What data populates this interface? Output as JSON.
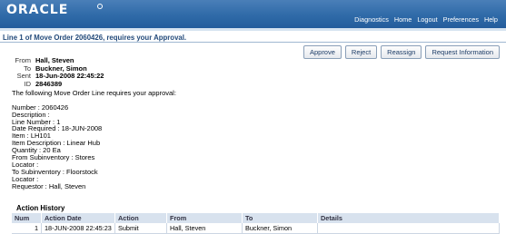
{
  "header": {
    "logo": "ORACLE",
    "nav": [
      "Diagnostics",
      "Home",
      "Logout",
      "Preferences",
      "Help"
    ]
  },
  "page_title": "Line 1 of Move Order 2060426, requires your Approval.",
  "buttons": [
    "Approve",
    "Reject",
    "Reassign",
    "Request Information"
  ],
  "notification": {
    "from_label": "From",
    "from": "Hall, Steven",
    "to_label": "To",
    "to": "Buckner, Simon",
    "sent_label": "Sent",
    "sent": "18-Jun-2008 22:45:22",
    "id_label": "ID",
    "id": "2846389"
  },
  "body_lines": [
    "The following Move Order Line requires your approval:",
    "",
    "Number : 2060426",
    "Description :",
    "Line Number : 1",
    "Date Required : 18-JUN-2008",
    "Item : LH101",
    "Item Description : Linear Hub",
    "Quantity : 20 Ea",
    "From Subinventory : Stores",
    "Locator :",
    "To Subinventory : Floorstock",
    "Locator :",
    "Requestor : Hall, Steven"
  ],
  "action_history": {
    "title": "Action History",
    "columns": [
      "Num",
      "Action Date",
      "Action",
      "From",
      "To",
      "Details"
    ],
    "rows": [
      [
        "1",
        "18-JUN-2008 22:45:23",
        "Submit",
        "Hall, Steven",
        "Buckner, Simon",
        ""
      ]
    ]
  }
}
